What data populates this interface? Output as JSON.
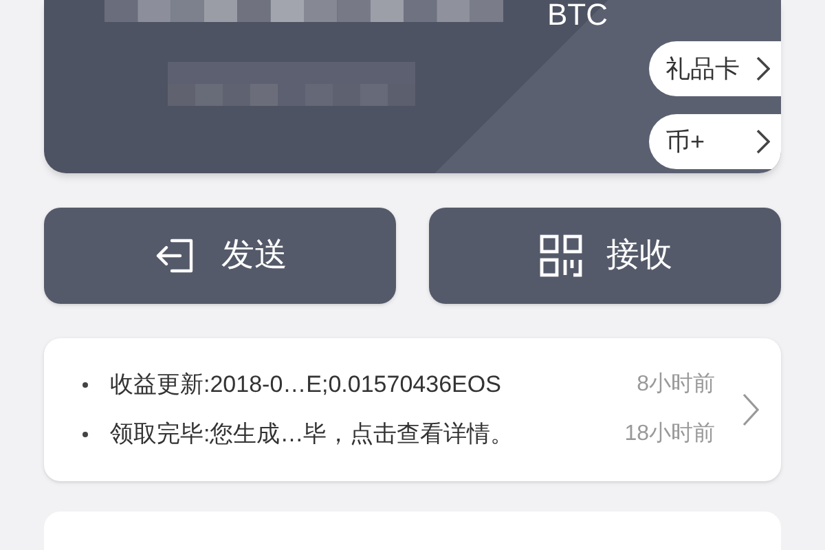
{
  "card": {
    "currency": "BTC",
    "links": [
      {
        "label": "礼品卡"
      },
      {
        "label": "币+"
      }
    ]
  },
  "actions": [
    {
      "kind": "send",
      "label": "发送"
    },
    {
      "kind": "receive",
      "label": "接收"
    }
  ],
  "notifications": [
    {
      "text": "收益更新:2018-0…E;0.01570436EOS",
      "time": "8小时前"
    },
    {
      "text": "领取完毕:您生成…毕，点击查看详情。",
      "time": "18小时前"
    }
  ]
}
